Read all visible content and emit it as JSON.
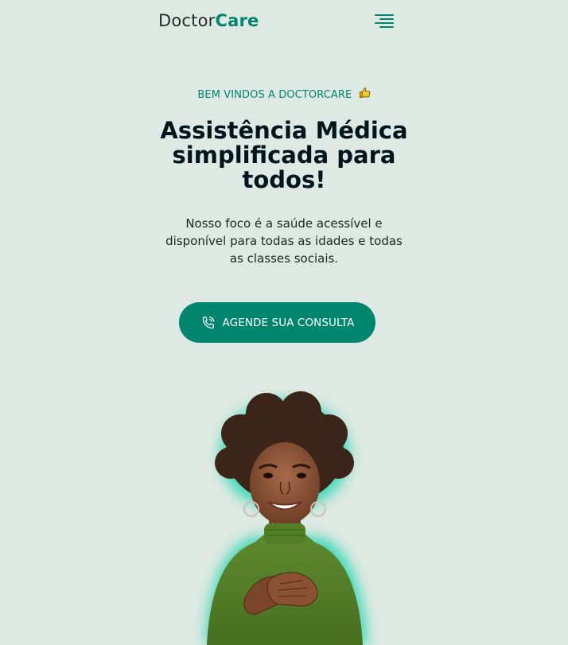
{
  "header": {
    "logo_part1": "Doctor",
    "logo_part2": "Care",
    "menu_icon": "hamburger-menu-icon"
  },
  "hero": {
    "eyebrow": "BEM VINDOS A DOCTORCARE",
    "eyebrow_icon": "thumbs-up-icon",
    "title_line1": "Assistência Médica",
    "title_line2": "simplificada para",
    "title_line3": "todos!",
    "subtitle_line1": "Nosso foco é a saúde acessível e",
    "subtitle_line2": "disponível para todas as idades e todas",
    "subtitle_line3": "as classes sociais.",
    "cta_label": "AGENDE SUA CONSULTA",
    "cta_icon": "phone-icon"
  },
  "colors": {
    "background": "#dfe9e3",
    "brand": "#00856f",
    "text": "#00161c"
  }
}
